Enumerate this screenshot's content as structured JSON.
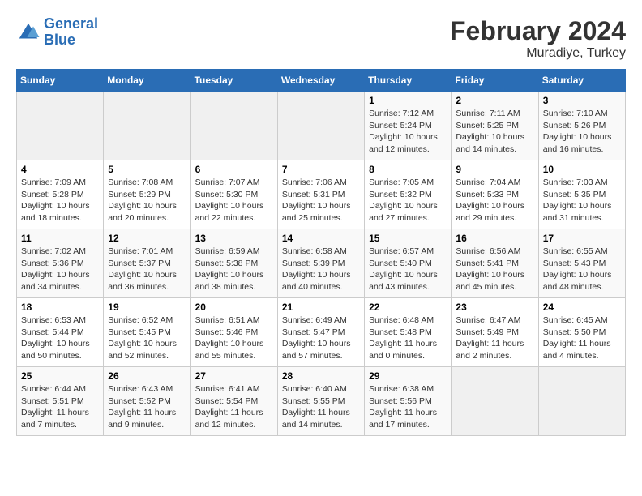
{
  "logo": {
    "line1": "General",
    "line2": "Blue"
  },
  "title": "February 2024",
  "subtitle": "Muradiye, Turkey",
  "headers": [
    "Sunday",
    "Monday",
    "Tuesday",
    "Wednesday",
    "Thursday",
    "Friday",
    "Saturday"
  ],
  "weeks": [
    [
      {
        "num": "",
        "info": ""
      },
      {
        "num": "",
        "info": ""
      },
      {
        "num": "",
        "info": ""
      },
      {
        "num": "",
        "info": ""
      },
      {
        "num": "1",
        "info": "Sunrise: 7:12 AM\nSunset: 5:24 PM\nDaylight: 10 hours\nand 12 minutes."
      },
      {
        "num": "2",
        "info": "Sunrise: 7:11 AM\nSunset: 5:25 PM\nDaylight: 10 hours\nand 14 minutes."
      },
      {
        "num": "3",
        "info": "Sunrise: 7:10 AM\nSunset: 5:26 PM\nDaylight: 10 hours\nand 16 minutes."
      }
    ],
    [
      {
        "num": "4",
        "info": "Sunrise: 7:09 AM\nSunset: 5:28 PM\nDaylight: 10 hours\nand 18 minutes."
      },
      {
        "num": "5",
        "info": "Sunrise: 7:08 AM\nSunset: 5:29 PM\nDaylight: 10 hours\nand 20 minutes."
      },
      {
        "num": "6",
        "info": "Sunrise: 7:07 AM\nSunset: 5:30 PM\nDaylight: 10 hours\nand 22 minutes."
      },
      {
        "num": "7",
        "info": "Sunrise: 7:06 AM\nSunset: 5:31 PM\nDaylight: 10 hours\nand 25 minutes."
      },
      {
        "num": "8",
        "info": "Sunrise: 7:05 AM\nSunset: 5:32 PM\nDaylight: 10 hours\nand 27 minutes."
      },
      {
        "num": "9",
        "info": "Sunrise: 7:04 AM\nSunset: 5:33 PM\nDaylight: 10 hours\nand 29 minutes."
      },
      {
        "num": "10",
        "info": "Sunrise: 7:03 AM\nSunset: 5:35 PM\nDaylight: 10 hours\nand 31 minutes."
      }
    ],
    [
      {
        "num": "11",
        "info": "Sunrise: 7:02 AM\nSunset: 5:36 PM\nDaylight: 10 hours\nand 34 minutes."
      },
      {
        "num": "12",
        "info": "Sunrise: 7:01 AM\nSunset: 5:37 PM\nDaylight: 10 hours\nand 36 minutes."
      },
      {
        "num": "13",
        "info": "Sunrise: 6:59 AM\nSunset: 5:38 PM\nDaylight: 10 hours\nand 38 minutes."
      },
      {
        "num": "14",
        "info": "Sunrise: 6:58 AM\nSunset: 5:39 PM\nDaylight: 10 hours\nand 40 minutes."
      },
      {
        "num": "15",
        "info": "Sunrise: 6:57 AM\nSunset: 5:40 PM\nDaylight: 10 hours\nand 43 minutes."
      },
      {
        "num": "16",
        "info": "Sunrise: 6:56 AM\nSunset: 5:41 PM\nDaylight: 10 hours\nand 45 minutes."
      },
      {
        "num": "17",
        "info": "Sunrise: 6:55 AM\nSunset: 5:43 PM\nDaylight: 10 hours\nand 48 minutes."
      }
    ],
    [
      {
        "num": "18",
        "info": "Sunrise: 6:53 AM\nSunset: 5:44 PM\nDaylight: 10 hours\nand 50 minutes."
      },
      {
        "num": "19",
        "info": "Sunrise: 6:52 AM\nSunset: 5:45 PM\nDaylight: 10 hours\nand 52 minutes."
      },
      {
        "num": "20",
        "info": "Sunrise: 6:51 AM\nSunset: 5:46 PM\nDaylight: 10 hours\nand 55 minutes."
      },
      {
        "num": "21",
        "info": "Sunrise: 6:49 AM\nSunset: 5:47 PM\nDaylight: 10 hours\nand 57 minutes."
      },
      {
        "num": "22",
        "info": "Sunrise: 6:48 AM\nSunset: 5:48 PM\nDaylight: 11 hours\nand 0 minutes."
      },
      {
        "num": "23",
        "info": "Sunrise: 6:47 AM\nSunset: 5:49 PM\nDaylight: 11 hours\nand 2 minutes."
      },
      {
        "num": "24",
        "info": "Sunrise: 6:45 AM\nSunset: 5:50 PM\nDaylight: 11 hours\nand 4 minutes."
      }
    ],
    [
      {
        "num": "25",
        "info": "Sunrise: 6:44 AM\nSunset: 5:51 PM\nDaylight: 11 hours\nand 7 minutes."
      },
      {
        "num": "26",
        "info": "Sunrise: 6:43 AM\nSunset: 5:52 PM\nDaylight: 11 hours\nand 9 minutes."
      },
      {
        "num": "27",
        "info": "Sunrise: 6:41 AM\nSunset: 5:54 PM\nDaylight: 11 hours\nand 12 minutes."
      },
      {
        "num": "28",
        "info": "Sunrise: 6:40 AM\nSunset: 5:55 PM\nDaylight: 11 hours\nand 14 minutes."
      },
      {
        "num": "29",
        "info": "Sunrise: 6:38 AM\nSunset: 5:56 PM\nDaylight: 11 hours\nand 17 minutes."
      },
      {
        "num": "",
        "info": ""
      },
      {
        "num": "",
        "info": ""
      }
    ]
  ]
}
